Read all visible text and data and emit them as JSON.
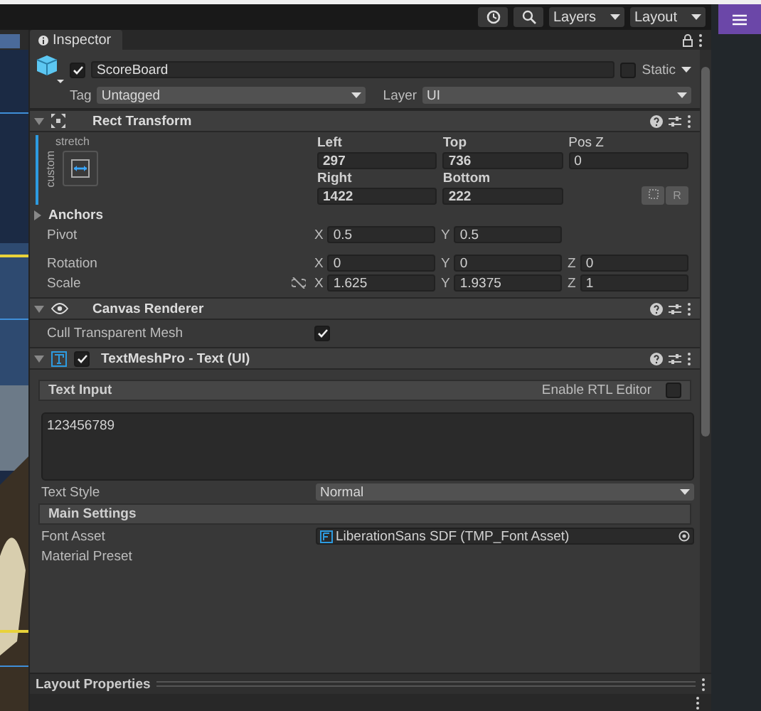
{
  "toolbar": {
    "dropdowns": [
      "Layers",
      "Layout"
    ]
  },
  "inspector": {
    "tab": "Inspector",
    "object": {
      "active": true,
      "name": "ScoreBoard",
      "static_label": "Static",
      "static": false,
      "tag_label": "Tag",
      "tag": "Untagged",
      "layer_label": "Layer",
      "layer": "UI"
    },
    "rect_transform": {
      "title": "Rect Transform",
      "expanded": true,
      "anchor_top": "stretch",
      "anchor_side": "custom",
      "offsets": [
        {
          "label": "Left",
          "value": "297"
        },
        {
          "label": "Top",
          "value": "736"
        },
        {
          "label": "Pos Z",
          "value": "0"
        },
        {
          "label": "Right",
          "value": "1422"
        },
        {
          "label": "Bottom",
          "value": "222"
        }
      ],
      "raw_button": "R",
      "anchors": {
        "label": "Anchors",
        "expanded": false
      },
      "vectors": [
        {
          "label": "Pivot",
          "linked": false,
          "axes": [
            {
              "axis": "X",
              "value": "0.5"
            },
            {
              "axis": "Y",
              "value": "0.5"
            }
          ]
        },
        {
          "label": "Rotation",
          "linked": false,
          "axes": [
            {
              "axis": "X",
              "value": "0"
            },
            {
              "axis": "Y",
              "value": "0"
            },
            {
              "axis": "Z",
              "value": "0"
            }
          ]
        },
        {
          "label": "Scale",
          "linked": true,
          "axes": [
            {
              "axis": "X",
              "value": "1.625"
            },
            {
              "axis": "Y",
              "value": "1.9375"
            },
            {
              "axis": "Z",
              "value": "1"
            }
          ]
        }
      ]
    },
    "canvas_renderer": {
      "title": "Canvas Renderer",
      "expanded": true,
      "cull_label": "Cull Transparent Mesh",
      "cull": true
    },
    "text_mesh_pro": {
      "title": "TextMeshPro - Text (UI)",
      "expanded": true,
      "enabled": true,
      "text_input_label": "Text Input",
      "rtl_label": "Enable RTL Editor",
      "rtl": false,
      "text": "123456789",
      "text_style_label": "Text Style",
      "text_style": "Normal",
      "main_settings_label": "Main Settings",
      "font_asset_label": "Font Asset",
      "font_asset": "LiberationSans SDF (TMP_Font Asset)",
      "material_preset_label": "Material Preset"
    },
    "layout_properties": "Layout Properties"
  }
}
